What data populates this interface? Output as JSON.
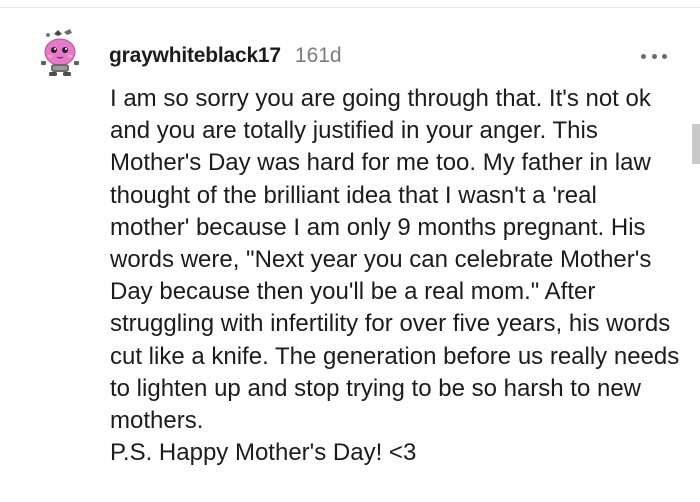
{
  "comment": {
    "username": "graywhiteblack17",
    "age": "161d",
    "body": [
      "I am so sorry you are going through that. It's not ok and you are totally justified in your anger. This Mother's Day was hard for me too. My father in law thought of the brilliant idea that I wasn't a 'real mother' because I am only 9 months pregnant. His words were, \"Next year you can celebrate Mother's Day because then you'll be a real mom.\" After struggling with infertility for over five years, his words cut like a knife. The generation before us really needs to lighten up and stop trying to be so harsh to new mothers.",
      "P.S. Happy Mother's Day! <3"
    ],
    "avatar_icon": "snoo-avatar-icon",
    "more_icon": "more-options-icon"
  },
  "colors": {
    "text": "#1c1c1c",
    "meta": "#7c7c7c",
    "avatar_pink": "#e879c9",
    "icon": "#6b6b6b"
  }
}
